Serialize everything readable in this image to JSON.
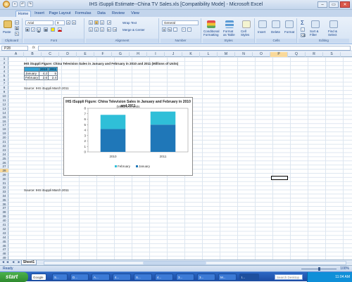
{
  "window": {
    "title": "IHS iSuppli Estimate--China TV Sales.xls  [Compatibility Mode]  - Microsoft Excel",
    "controls": [
      "–",
      "▭",
      "✕"
    ]
  },
  "ribbon_tabs": [
    "Home",
    "Insert",
    "Page Layout",
    "Formulas",
    "Data",
    "Review",
    "View"
  ],
  "ribbon": {
    "clipboard": {
      "paste": "Paste",
      "label": "Clipboard"
    },
    "font": {
      "name": "Arial",
      "size": "9",
      "label": "Font",
      "grow": "A",
      "shrink": "A",
      "bold": "B",
      "italic": "I",
      "underline": "U",
      "color": "A"
    },
    "alignment": {
      "wrap": "Wrap Text",
      "merge": "Merge & Center",
      "label": "Alignment"
    },
    "number": {
      "format": "General",
      "currency": "$",
      "percent": "%",
      "comma": ",",
      "label": "Number"
    },
    "styles": {
      "conditional": "Conditional Formatting",
      "format_table": "Format as Table",
      "cell_styles": "Cell Styles",
      "label": "Styles"
    },
    "cells": {
      "insert": "Insert",
      "delete": "Delete",
      "format": "Format",
      "label": "Cells"
    },
    "editing": {
      "sum": "Σ",
      "sort": "Sort & Filter",
      "find": "Find & Select",
      "label": "Editing"
    }
  },
  "formula_bar": {
    "name_box": "P28",
    "fx": "fx",
    "value": ""
  },
  "columns": [
    "A",
    "B",
    "C",
    "D",
    "E",
    "F",
    "G",
    "H",
    "I",
    "J",
    "K",
    "L",
    "M",
    "N",
    "O",
    "P",
    "Q",
    "R",
    "S"
  ],
  "selected_column": "P",
  "rows": [
    "1",
    "2",
    "3",
    "4",
    "5",
    "6",
    "7",
    "8",
    "9",
    "10",
    "11",
    "12",
    "13",
    "14",
    "15",
    "16",
    "17",
    "18",
    "19",
    "20",
    "21",
    "22",
    "23",
    "24",
    "25",
    "26",
    "27",
    "28",
    "29",
    "30",
    "31",
    "32",
    "33",
    "34",
    "35",
    "36",
    "37",
    "38",
    "39",
    "40",
    "41",
    "42",
    "43",
    "44",
    "45",
    "46",
    "47",
    "48",
    "49"
  ],
  "selected_row": "28",
  "sheet": {
    "title": "IHS iSuppli Figure: China Television Sales in January and February in 2010 and 2011 (Millions of Units)",
    "table_headers": [
      "",
      "2010",
      "2011"
    ],
    "table_rows": [
      {
        "label": "January",
        "v2010": "4.2",
        "v2011": "5"
      },
      {
        "label": "February",
        "v2010": "2.6",
        "v2011": "2.4"
      }
    ],
    "source1": "Source: IHS iSuppli March 2011",
    "source2": "Source: IHS iSuppli March 2011"
  },
  "chart_data": {
    "type": "bar",
    "stacked": true,
    "title": "IHS iSuppli Figure: China Television Sales in January and February in 2010 and 2011",
    "subtitle": "(Millions of Units",
    "categories": [
      "2010",
      "2011"
    ],
    "series": [
      {
        "name": "January",
        "values": [
          4.2,
          5.0
        ],
        "color": "#1f77b8"
      },
      {
        "name": "February",
        "values": [
          2.6,
          2.4
        ],
        "color": "#2fbfd8"
      }
    ],
    "yticks": [
      "0",
      "1",
      "2",
      "3",
      "4",
      "5",
      "6",
      "7",
      "8"
    ],
    "ylim": [
      0,
      8
    ],
    "legend": "bottom"
  },
  "sheet_tabs": {
    "active": "Sheet1",
    "nav": "◄◄ ◄ ► ►►"
  },
  "status": {
    "text": "Ready",
    "zoom": "100%"
  },
  "taskbar": {
    "start": "start",
    "buttons": [
      "Google",
      "S...",
      "D...",
      "A...",
      "4...",
      "S...",
      "4...",
      "3...",
      "3...",
      "M...",
      "I..."
    ],
    "search": "Search Desktop",
    "clock": "11:04 AM"
  }
}
